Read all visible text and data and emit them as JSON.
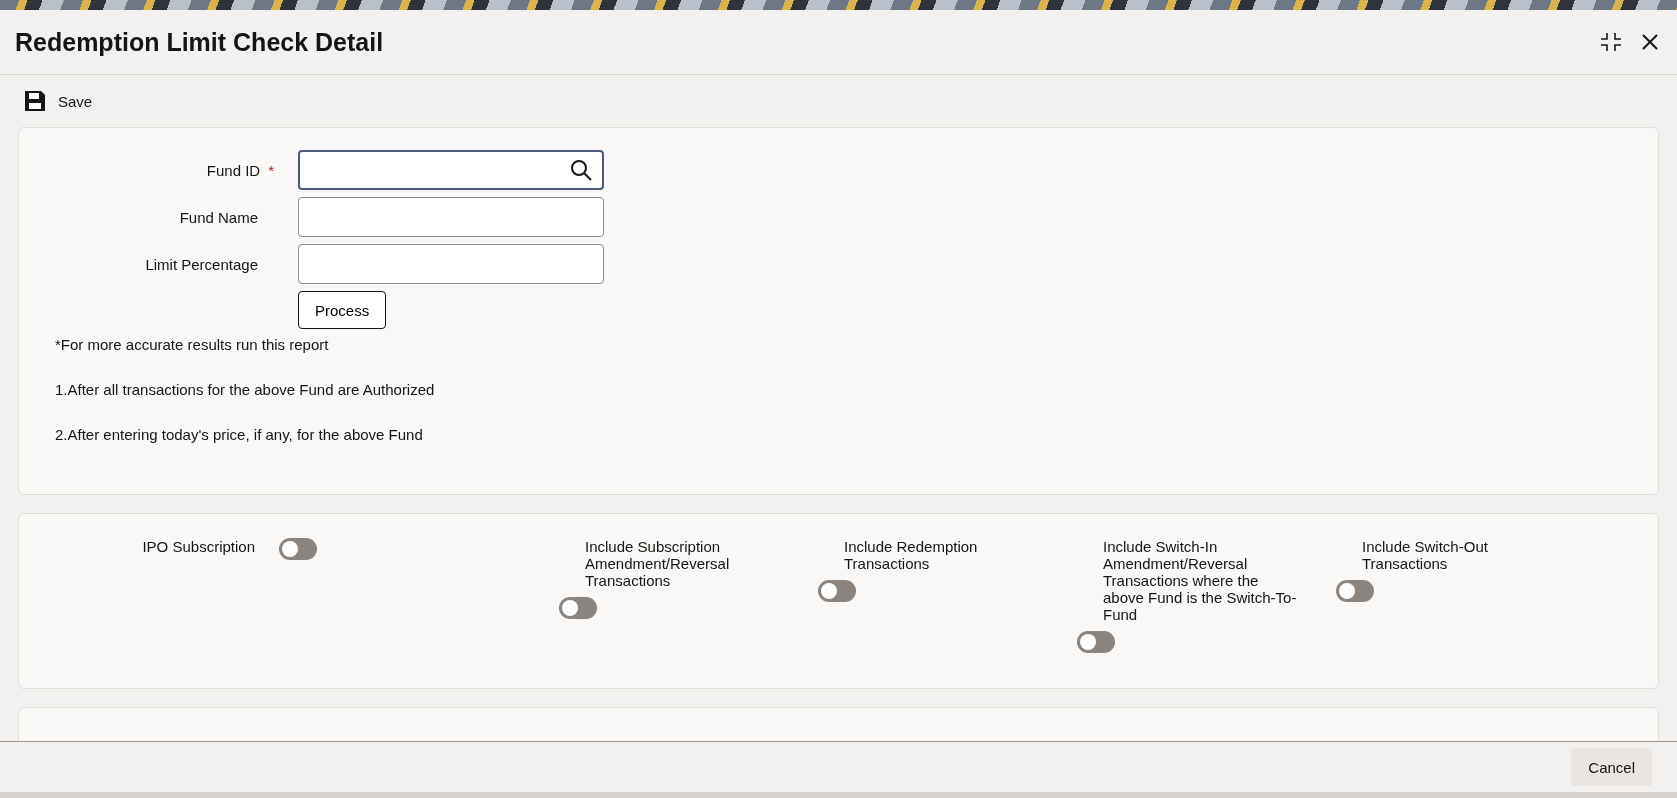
{
  "window": {
    "title": "Redemption Limit Check Detail"
  },
  "toolbar": {
    "save": "Save"
  },
  "form": {
    "fields": [
      {
        "label": "Fund ID",
        "required_mark": "*",
        "kind": "lookup",
        "focused": true
      },
      {
        "label": "Fund Name",
        "kind": "text",
        "focused": false
      },
      {
        "label": "Limit Percentage",
        "kind": "text",
        "focused": false
      }
    ],
    "process_button": "Process",
    "notes": [
      "*For more accurate results run this report",
      "1.After all transactions for the above Fund are Authorized",
      "2.After entering today's price, if any, for the above Fund"
    ]
  },
  "options": [
    {
      "label": "IPO Subscription",
      "kind": "inline",
      "on": false
    },
    {
      "label": "Include Subscription Amendment/Reversal Transactions",
      "kind": "stacked",
      "on": false
    },
    {
      "label": "Include Redemption Transactions",
      "kind": "stacked",
      "on": false
    },
    {
      "label": "Include Switch-In Amendment/Reversal Transactions where the above Fund is the Switch-To-Fund",
      "kind": "stacked",
      "on": false
    },
    {
      "label": "Include Switch-Out Transactions",
      "kind": "stacked",
      "on": false
    }
  ],
  "footer": {
    "cancel": "Cancel"
  }
}
